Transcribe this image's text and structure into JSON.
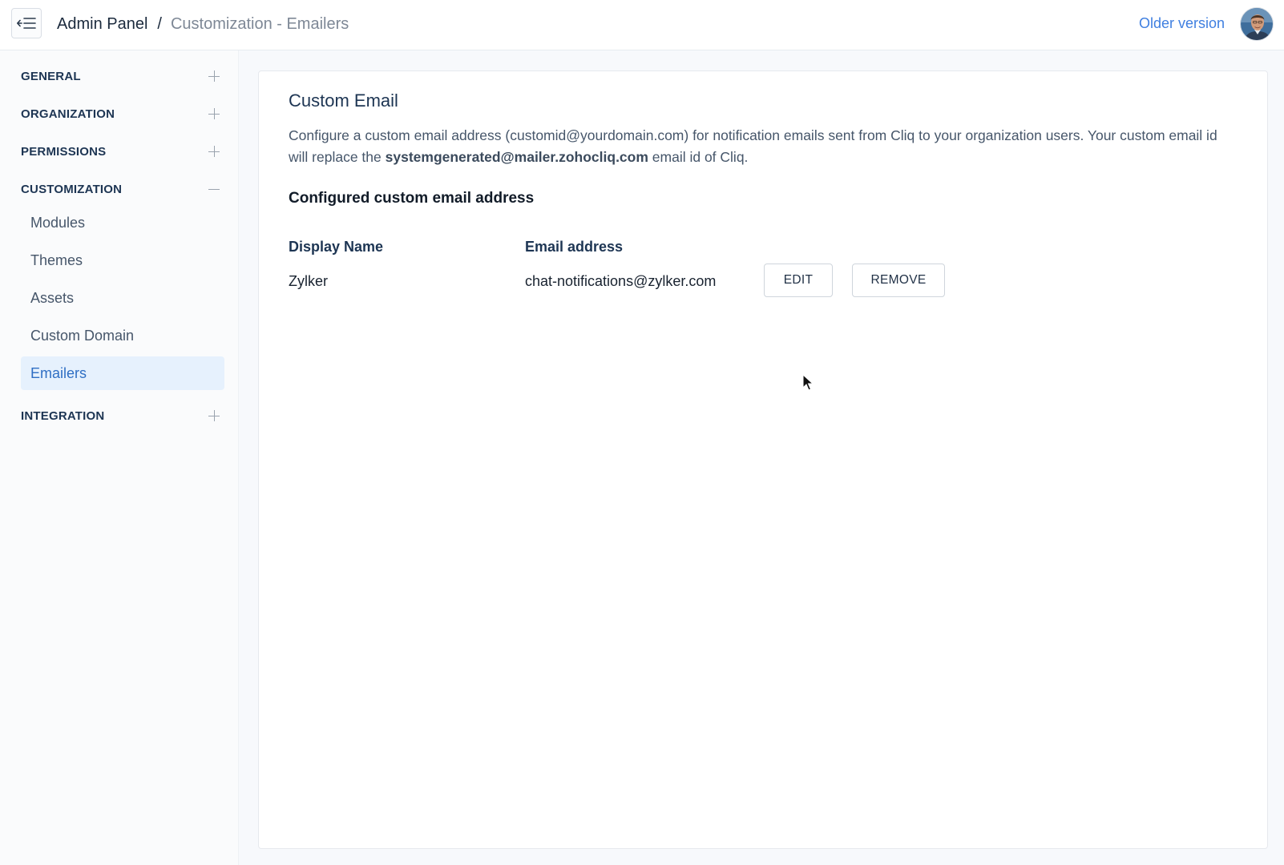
{
  "header": {
    "breadcrumb_root": "Admin Panel",
    "breadcrumb_separator": "/",
    "breadcrumb_current": "Customization - Emailers",
    "older_version_link": "Older version",
    "back_icon": "collapse-menu-icon",
    "avatar_icon": "user-avatar"
  },
  "sidebar": {
    "sections": [
      {
        "label": "GENERAL",
        "state": "collapsed"
      },
      {
        "label": "ORGANIZATION",
        "state": "collapsed"
      },
      {
        "label": "PERMISSIONS",
        "state": "collapsed"
      },
      {
        "label": "CUSTOMIZATION",
        "state": "expanded"
      },
      {
        "label": "INTEGRATION",
        "state": "collapsed"
      }
    ],
    "customization_items": [
      {
        "label": "Modules"
      },
      {
        "label": "Themes"
      },
      {
        "label": "Assets"
      },
      {
        "label": "Custom Domain"
      },
      {
        "label": "Emailers",
        "active": true
      }
    ]
  },
  "main": {
    "title": "Custom Email",
    "description_part1": "Configure a custom email address (customid@yourdomain.com) for notification emails sent from Cliq to your organization users. Your custom email id will replace the ",
    "description_bold": "systemgenerated@mailer.zohocliq.com",
    "description_part2": " email id of Cliq.",
    "subheading": "Configured custom email address",
    "table": {
      "headers": [
        "Display Name",
        "Email address"
      ],
      "rows": [
        {
          "display_name": "Zylker",
          "email": "chat-notifications@zylker.com"
        }
      ]
    },
    "edit_label": "EDIT",
    "remove_label": "REMOVE"
  },
  "colors": {
    "accent": "#3f7fe0",
    "active_bg": "#e6f1fd",
    "active_text": "#2f6fc4",
    "heading": "#1d3553"
  }
}
